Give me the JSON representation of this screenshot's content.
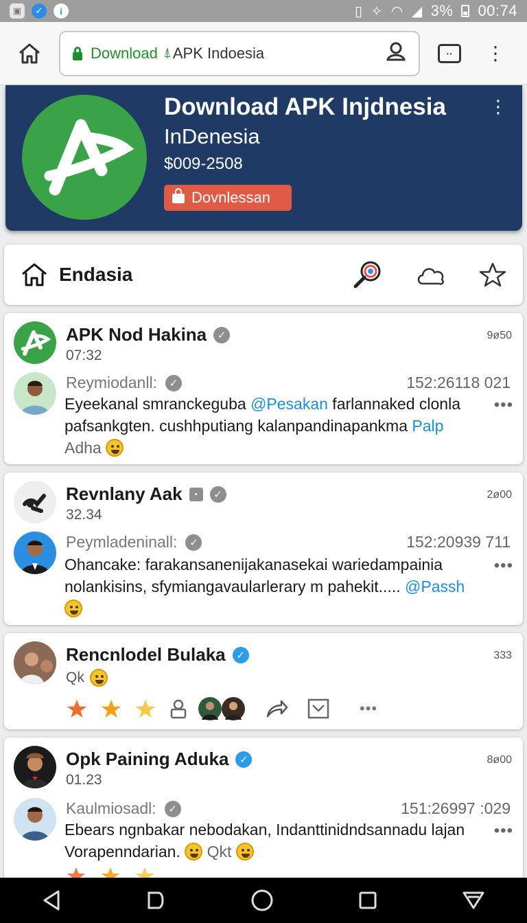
{
  "status_bar": {
    "battery": "3%",
    "time": "00:74"
  },
  "browser": {
    "url_green": "Download",
    "url_dark": "APK Indoesia"
  },
  "app": {
    "title": "Download APK Injdnesia",
    "subtitle": "InDenesia",
    "price": "$009-2508",
    "download_label": "Dovnlessan"
  },
  "nav": {
    "title": "Endasia"
  },
  "posts": [
    {
      "name": "APK Nod Hakina",
      "time": "07:32",
      "count": "9ø50",
      "reply_name": "Reymiodanll:",
      "reply_meta": "152:26118 021",
      "body_before": "Eyeekanal smranckeguba ",
      "mention1": "@Pesakan",
      "body_mid": " farlannaked clonla pafsankgten. cushhputiang kalanpandinapankma ",
      "mention2": "Palp",
      "tail": "Adha"
    },
    {
      "name": "Revnlany Aak",
      "time": "32.34",
      "count": "2ø00",
      "reply_name": "Peymladeninall:",
      "reply_meta": "152:20939 711",
      "body_before": "Ohancake: farakansanenijakanasekai wariedampainia nolankisins, sfymiangavaularlerary m pahekit..... ",
      "mention1": "@Passh"
    },
    {
      "name": "Rencnlodel Bulaka",
      "sub": "Qk",
      "count": "333"
    },
    {
      "name": "Opk Paining Aduka",
      "time": "01.23",
      "count": "8ø00",
      "reply_name": "Kaulmiosadl:",
      "reply_meta": "151:26997 :029",
      "body_before": "Ebears ngnbakar nebodakan, Indanttinidndsannadu lajan Vorapenndarian. ",
      "tail": "Qkt"
    }
  ],
  "colors": {
    "header_bg": "#1f3a64",
    "logo_green": "#3aa347",
    "download_red": "#e05a45",
    "mention_blue": "#1d8ed8",
    "verify_blue": "#2d9be8",
    "star_orange": "#ef6c2f",
    "star_gold": "#f4b41a"
  }
}
